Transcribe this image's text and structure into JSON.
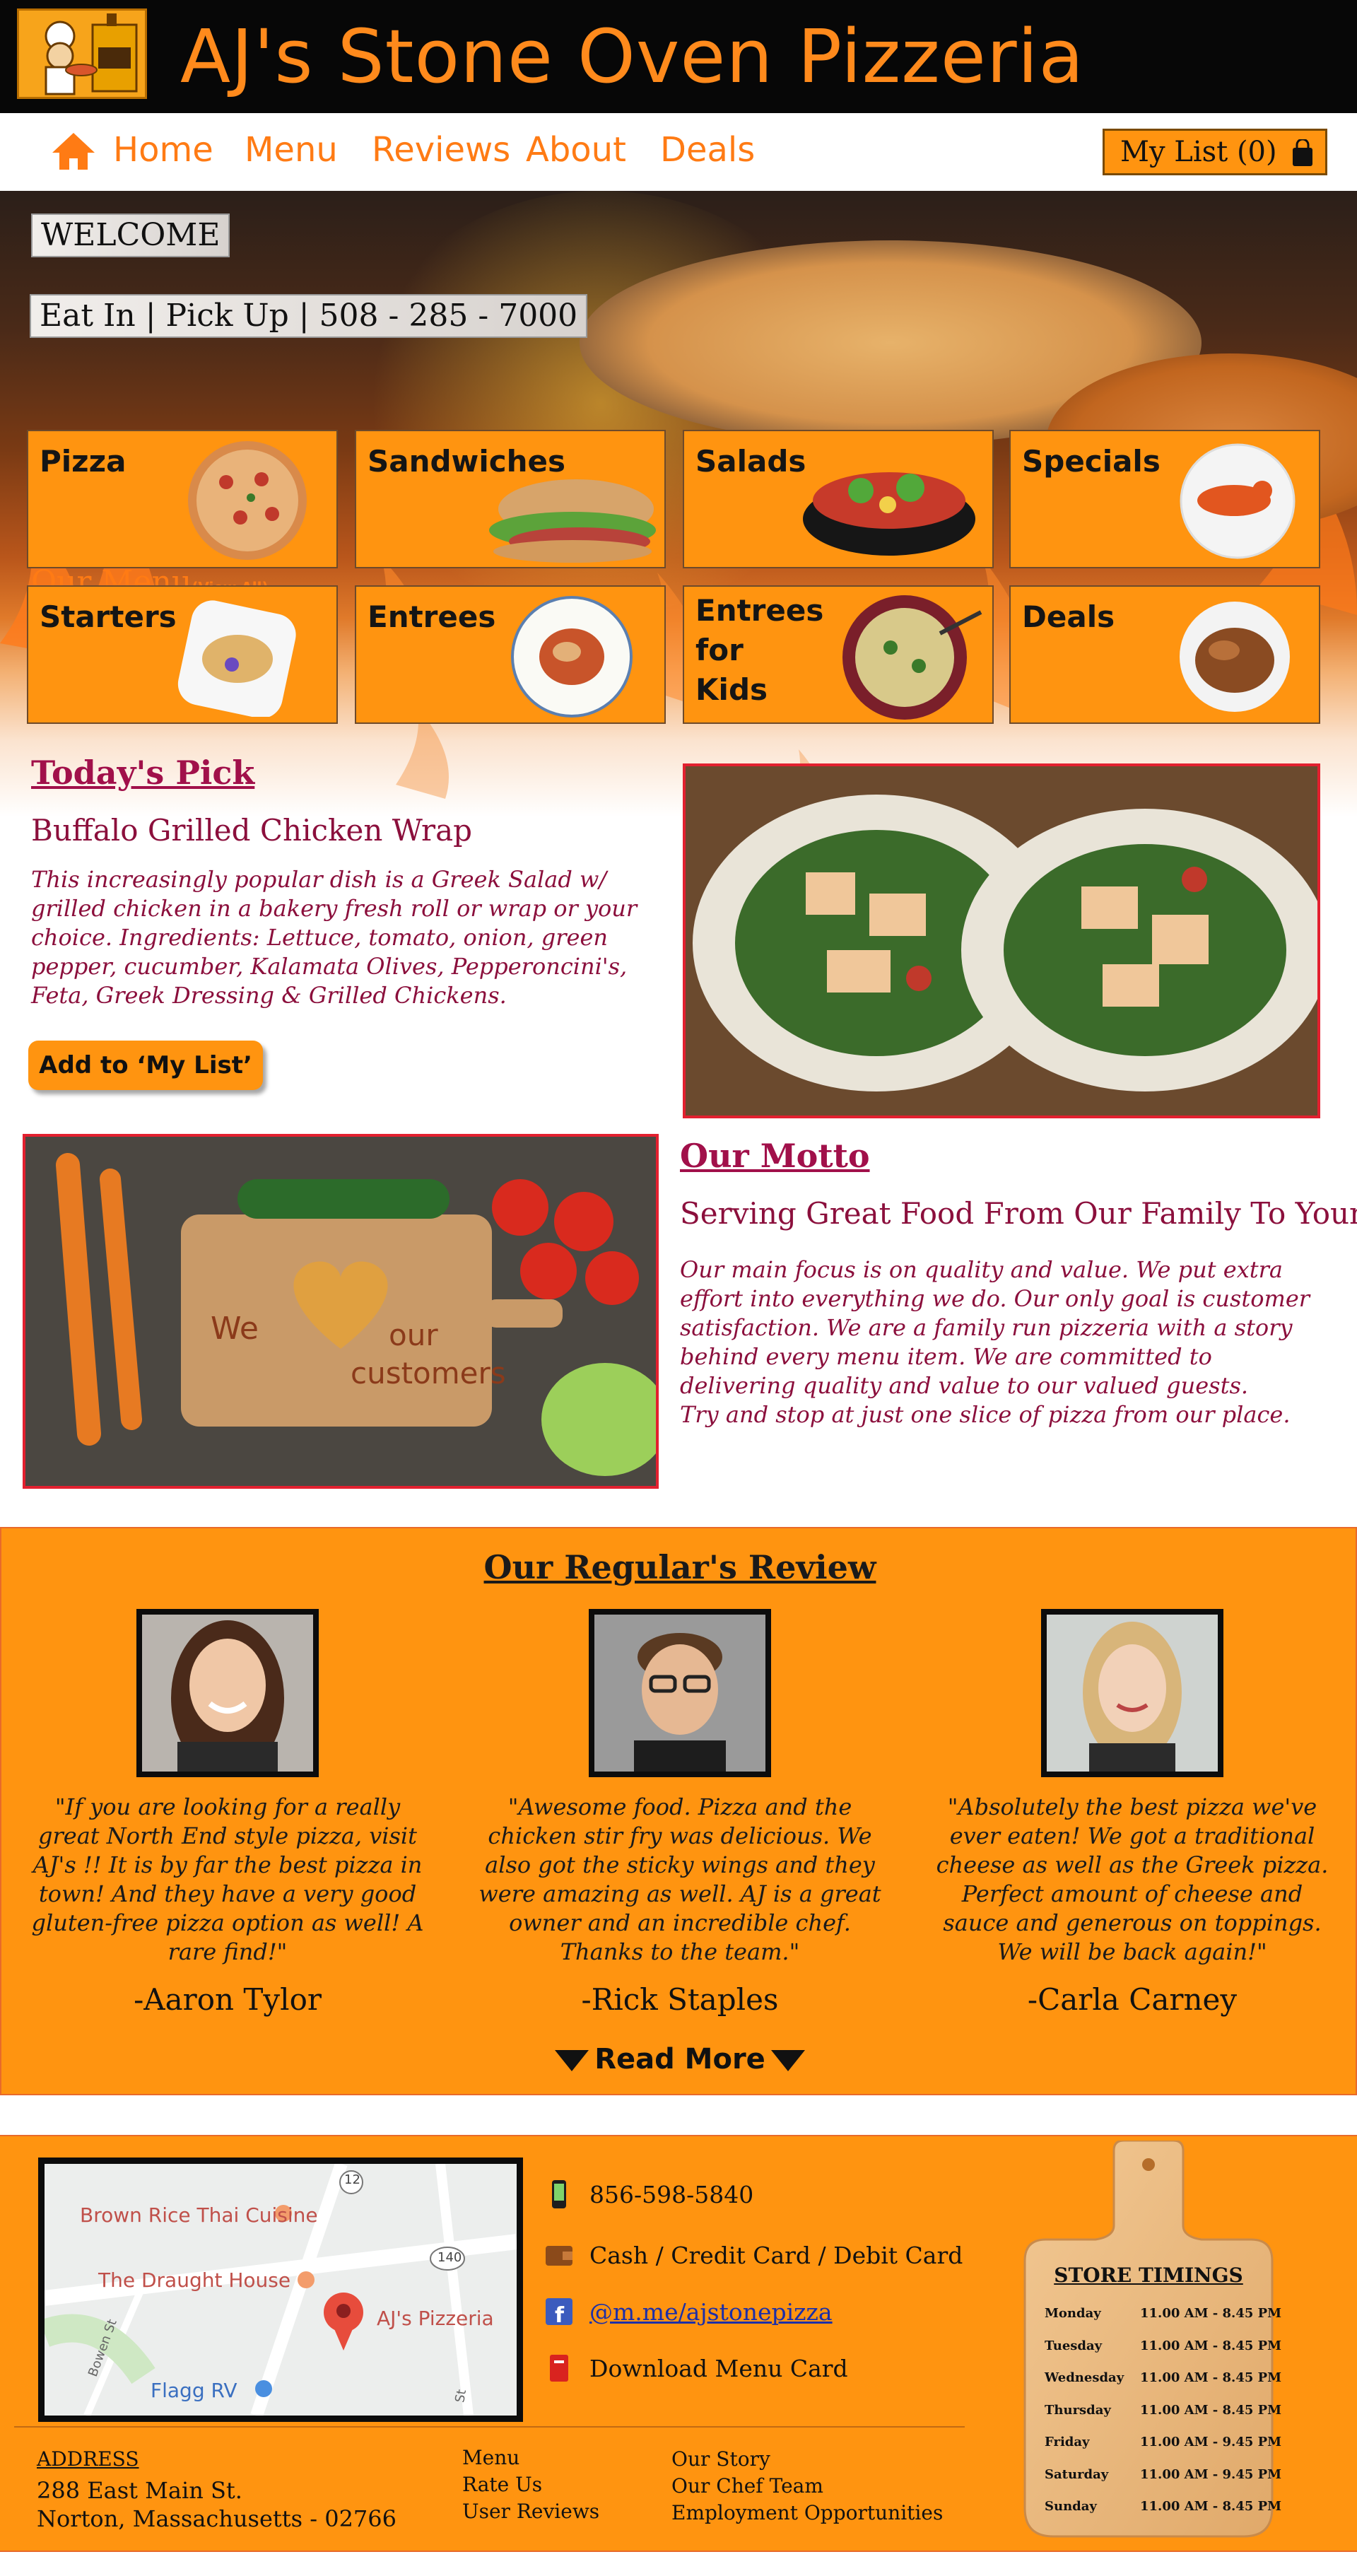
{
  "header": {
    "site_title": "AJ's Stone Oven Pizzeria",
    "logo_icon": "chef-pizza-oven-logo"
  },
  "nav": {
    "items": [
      {
        "label": "Home",
        "icon": "home-icon"
      },
      {
        "label": "Menu"
      },
      {
        "label": "Reviews"
      },
      {
        "label": "About"
      },
      {
        "label": "Deals"
      }
    ],
    "my_list": "My List (0)"
  },
  "hero": {
    "welcome": "WELCOME",
    "service_line": "Eat In | Pick Up | 508 - 285 - 7000",
    "our_menu": "Our Menu",
    "view_all": "(View All)"
  },
  "categories": [
    {
      "label": "Pizza"
    },
    {
      "label": "Sandwiches"
    },
    {
      "label": "Salads"
    },
    {
      "label": "Specials"
    },
    {
      "label": "Starters"
    },
    {
      "label": "Entrees"
    },
    {
      "label": "Entrees\nfor\nKids"
    },
    {
      "label": "Deals"
    }
  ],
  "todays_pick": {
    "heading": "Today's Pick",
    "dish": "Buffalo Grilled Chicken Wrap",
    "description": "This increasingly popular dish is a Greek Salad w/ grilled chicken in a bakery fresh roll or wrap or your choice. Ingredients: Lettuce, tomato, onion, green pepper, cucumber, Kalamata Olives, Pepperoncini's, Feta, Greek Dressing & Grilled Chickens.",
    "add_button": "Add to ‘My List’"
  },
  "motto": {
    "image_word_left": "We",
    "image_word_right1": "our",
    "image_word_right2": "customers",
    "heading": "Our Motto",
    "subheading": "Serving Great Food From Our Family To Yours",
    "body": "Our main focus is on quality and value. We put extra effort into everything we do. Our only goal is customer satisfaction. We are a family run pizzeria with a story behind every menu item. We are committed to delivering quality and value to our valued guests.",
    "body2": "Try and stop at just one slice of pizza from our place."
  },
  "reviews": {
    "title": "Our Regular's Review",
    "items": [
      {
        "quote": "\"If you are looking for a really great North End style pizza, visit AJ's !! It is by far the best pizza in town! And they have a very good gluten-free pizza option as well! A rare find!\"",
        "author": "-Aaron Tylor"
      },
      {
        "quote": "\"Awesome food. Pizza and the chicken stir fry was delicious. We also got the sticky wings and they were amazing as well. AJ is a great owner and an incredible chef. Thanks to the team.\"",
        "author": "-Rick Staples"
      },
      {
        "quote": "\"Absolutely the best pizza we've ever eaten! We got a traditional cheese as well as the Greek pizza. Perfect amount of cheese and sauce and generous on toppings. We will be back again!\"",
        "author": "-Carla Carney"
      }
    ],
    "read_more": "Read More"
  },
  "footer": {
    "map": {
      "places": [
        "Brown Rice Thai Cuisine",
        "The Draught House",
        "AJ's Pizzeria",
        "Flagg RV",
        "Bowen St",
        "St"
      ],
      "route_12": "12",
      "route_140": "140"
    },
    "phone": "856-598-5840",
    "payment": "Cash / Credit Card / Debit Card",
    "facebook": "@m.me/ajstonepizza",
    "download": "Download Menu Card",
    "address_label": "ADDRESS",
    "address_line1": "288 East Main St.",
    "address_line2": "Norton, Massachusetts - 02766",
    "links_col1": [
      "Menu",
      "Rate Us",
      "User Reviews"
    ],
    "links_col2": [
      "Our Story",
      "Our Chef Team",
      "Employment Opportunities"
    ],
    "timings_title": "STORE TIMINGS",
    "timings": [
      {
        "day": "Monday",
        "time": "11.00 AM - 8.45 PM"
      },
      {
        "day": "Tuesday",
        "time": "11.00 AM - 8.45 PM"
      },
      {
        "day": "Wednesday",
        "time": "11.00 AM - 8.45 PM"
      },
      {
        "day": "Thursday",
        "time": "11.00 AM - 8.45 PM"
      },
      {
        "day": "Friday",
        "time": "11.00 AM - 9.45 PM"
      },
      {
        "day": "Saturday",
        "time": "11.00 AM - 9.45 PM"
      },
      {
        "day": "Sunday",
        "time": "11.00 AM - 8.45 PM"
      }
    ]
  },
  "colors": {
    "brand_orange": "#ff9410",
    "title_orange": "#ff8a1c",
    "accent_maroon": "#8b0f3c",
    "photo_border_red": "#e2202f"
  }
}
